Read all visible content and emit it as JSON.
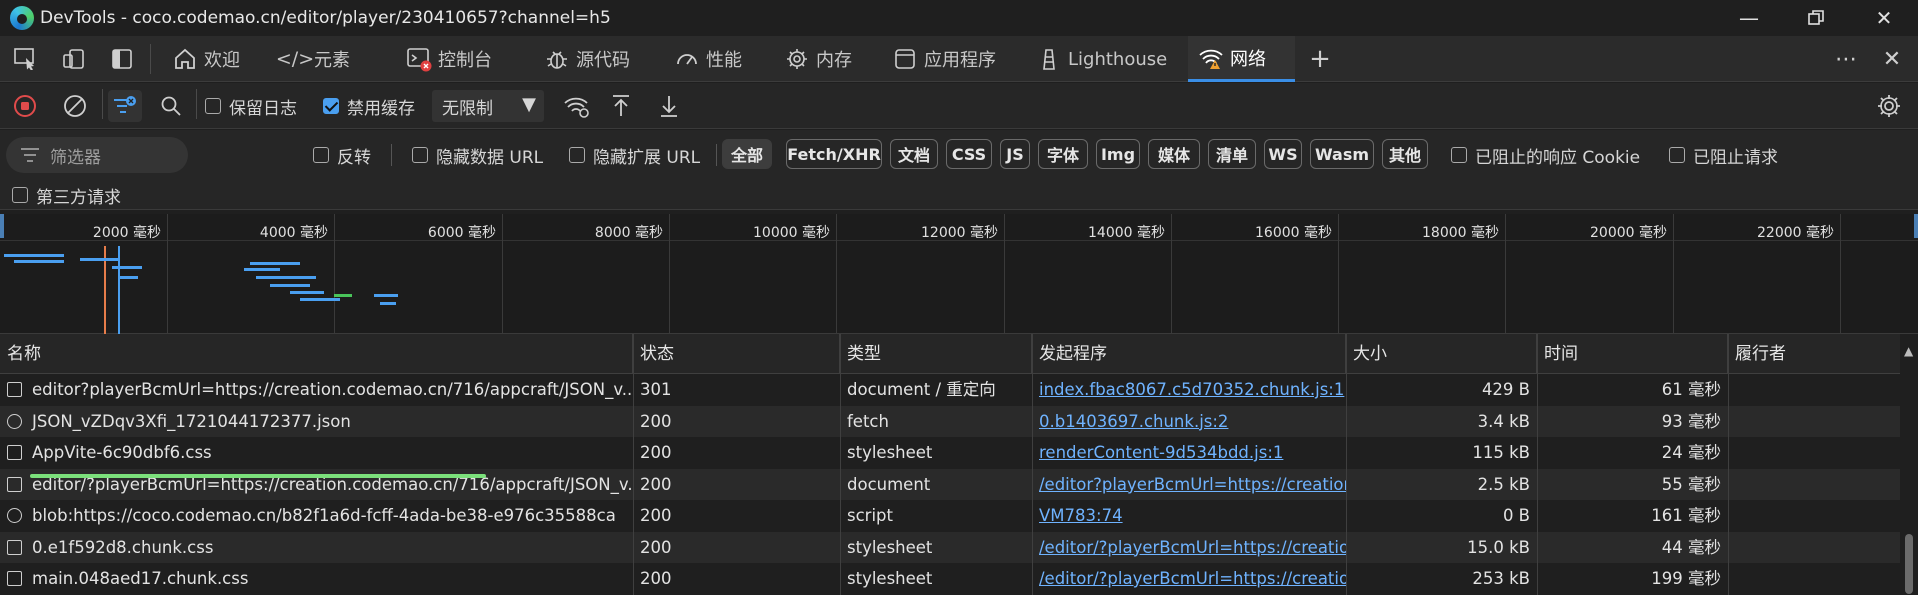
{
  "window": {
    "title": "DevTools - coco.codemao.cn/editor/player/230410657?channel=h5",
    "minimize_icon": "minimize-icon",
    "maximize_icon": "restore-icon",
    "close_icon": "close-icon"
  },
  "tabs": [
    {
      "label": "欢迎",
      "icon": "home-icon"
    },
    {
      "label": "元素",
      "icon": "code-tags-icon"
    },
    {
      "label": "控制台",
      "icon": "console-icon"
    },
    {
      "label": "源代码",
      "icon": "bug-icon"
    },
    {
      "label": "性能",
      "icon": "gauge-icon"
    },
    {
      "label": "内存",
      "icon": "chip-icon"
    },
    {
      "label": "应用程序",
      "icon": "app-window-icon"
    },
    {
      "label": "Lighthouse",
      "icon": "lighthouse-icon"
    },
    {
      "label": "网络",
      "icon": "wifi-icon",
      "active": true
    }
  ],
  "toolbar": {
    "preserve_log": "保留日志",
    "preserve_log_checked": false,
    "disable_cache": "禁用缓存",
    "disable_cache_checked": true,
    "throttle": "无限制"
  },
  "filters": {
    "placeholder": "筛选器",
    "invert": "反转",
    "hide_data_urls": "隐藏数据 URL",
    "hide_ext_urls": "隐藏扩展 URL",
    "types": [
      "全部",
      "Fetch/XHR",
      "文档",
      "CSS",
      "JS",
      "字体",
      "Img",
      "媒体",
      "清单",
      "WS",
      "Wasm",
      "其他"
    ],
    "blocked_cookies": "已阻止的响应 Cookie",
    "blocked_requests": "已阻止请求",
    "third_party": "第三方请求"
  },
  "timeline": {
    "ticks": [
      "2000 毫秒",
      "4000 毫秒",
      "6000 毫秒",
      "8000 毫秒",
      "10000 毫秒",
      "12000 毫秒",
      "14000 毫秒",
      "16000 毫秒",
      "18000 毫秒",
      "20000 毫秒",
      "22000 毫秒"
    ]
  },
  "table": {
    "headers": [
      "名称",
      "状态",
      "类型",
      "发起程序",
      "大小",
      "时间",
      "履行者"
    ],
    "rows": [
      {
        "name": "editor?playerBcmUrl=https://creation.codemao.cn/716/appcraft/JSON_v...",
        "status": "301",
        "type": "document / 重定向",
        "initiator": "index.fbac8067.c5d70352.chunk.js:1",
        "size": "429 B",
        "time": "61 毫秒",
        "icon": "document-icon"
      },
      {
        "name": "JSON_vZDqv3Xfi_1721044172377.json",
        "status": "200",
        "type": "fetch",
        "initiator": "0.b1403697.chunk.js:2",
        "size": "3.4 kB",
        "time": "93 毫秒",
        "icon": "json-icon"
      },
      {
        "name": "AppVite-6c90dbf6.css",
        "status": "200",
        "type": "stylesheet",
        "initiator": "renderContent-9d534bdd.js:1",
        "size": "115 kB",
        "time": "24 毫秒",
        "icon": "stylesheet-icon"
      },
      {
        "name": "editor/?playerBcmUrl=https://creation.codemao.cn/716/appcraft/JSON_v...",
        "status": "200",
        "type": "document",
        "initiator": "/editor?playerBcmUrl=https://creation.c",
        "size": "2.5 kB",
        "time": "55 毫秒",
        "icon": "document-icon"
      },
      {
        "name": "blob:https://coco.codemao.cn/b82f1a6d-fcff-4ada-be38-e976c35588ca",
        "status": "200",
        "type": "script",
        "initiator": "VM783:74",
        "size": "0 B",
        "time": "161 毫秒",
        "icon": "script-icon"
      },
      {
        "name": "0.e1f592d8.chunk.css",
        "status": "200",
        "type": "stylesheet",
        "initiator": "/editor/?playerBcmUrl=https://creation",
        "size": "15.0 kB",
        "time": "44 毫秒",
        "icon": "stylesheet-icon"
      },
      {
        "name": "main.048aed17.chunk.css",
        "status": "200",
        "type": "stylesheet",
        "initiator": "/editor/?playerBcmUrl=https://creation",
        "size": "253 kB",
        "time": "199 毫秒",
        "icon": "stylesheet-icon"
      }
    ]
  }
}
